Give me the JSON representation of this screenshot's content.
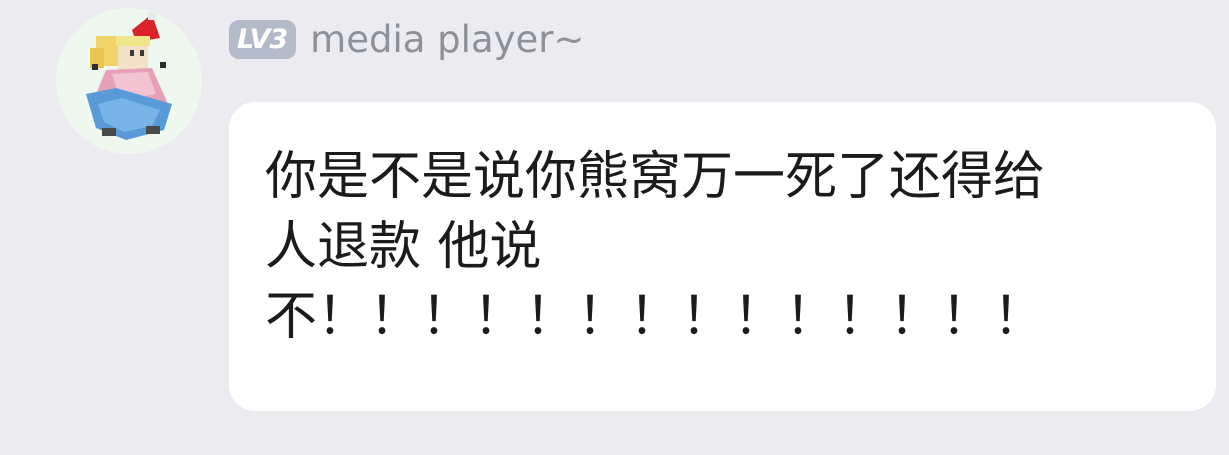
{
  "sender": {
    "avatar_icon": "pixel-character-red-hat-icon",
    "level_badge": "LV3",
    "username": "media player~"
  },
  "message": {
    "lines": [
      "你是不是说你熊窝万一死了还得给",
      "人退款 他说",
      "不！！！！！！！！！！！！！！"
    ]
  },
  "colors": {
    "background": "#ebebf0",
    "bubble": "#ffffff",
    "badge": "#b3bac9",
    "username": "#8d929a",
    "text": "#1b1b1b"
  }
}
